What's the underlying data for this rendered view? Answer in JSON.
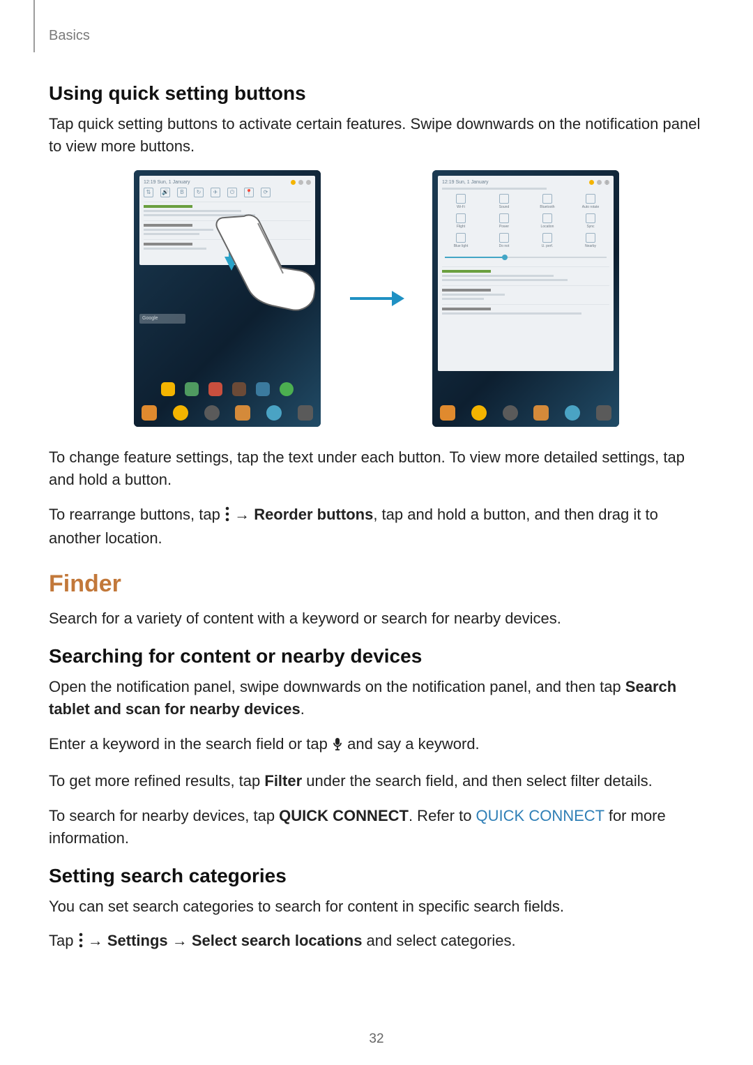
{
  "breadcrumb": "Basics",
  "h_quick": "Using quick setting buttons",
  "p_quick": "Tap quick setting buttons to activate certain features. Swipe downwards on the notification panel to view more buttons.",
  "p_change": "To change feature settings, tap the text under each button. To view more detailed settings, tap and hold a button.",
  "p_rearrange_1": "To rearrange buttons, tap ",
  "p_rearrange_2": " → ",
  "p_rearrange_bold": "Reorder buttons",
  "p_rearrange_3": ", tap and hold a button, and then drag it to another location.",
  "h_finder": "Finder",
  "p_finder": "Search for a variety of content with a keyword or search for nearby devices.",
  "h_search": "Searching for content or nearby devices",
  "p_search_1": "Open the notification panel, swipe downwards on the notification panel, and then tap ",
  "p_search_bold": "Search tablet and scan for nearby devices",
  "p_search_2": ".",
  "p_enter_1": "Enter a keyword in the search field or tap ",
  "p_enter_2": " and say a keyword.",
  "p_filter_1": "To get more refined results, tap ",
  "p_filter_bold": "Filter",
  "p_filter_2": " under the search field, and then select filter details.",
  "p_qc_1": "To search for nearby devices, tap ",
  "p_qc_bold": "QUICK CONNECT",
  "p_qc_2": ". Refer to ",
  "p_qc_link": "QUICK CONNECT",
  "p_qc_3": " for more information.",
  "h_cat": "Setting search categories",
  "p_cat": "You can set search categories to search for content in specific search fields.",
  "p_cat2_1": "Tap ",
  "p_cat2_2": " → ",
  "p_cat2_b1": "Settings",
  "p_cat2_3": " → ",
  "p_cat2_b2": "Select search locations",
  "p_cat2_4": " and select categories.",
  "page_number": "32",
  "fig": {
    "gsearch": "Google",
    "qs_labels": [
      "Wi-Fi",
      "Sound",
      "Bluetooth",
      "Auto rotate",
      "Flight",
      "Power",
      "Location",
      "Sync",
      "Blue light",
      "Do not",
      "U. perf.",
      "Nearby"
    ]
  }
}
